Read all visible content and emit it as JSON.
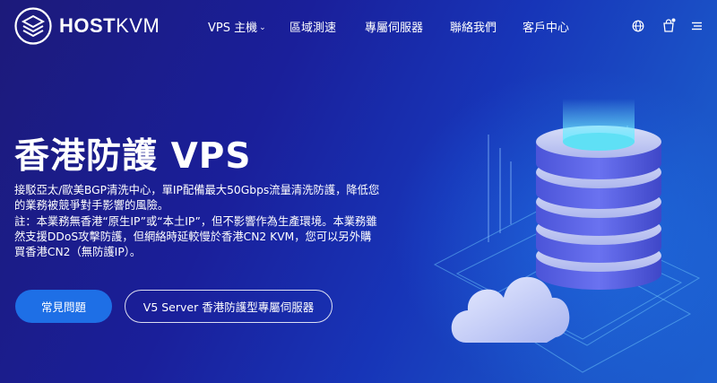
{
  "brand": {
    "name_bold": "HOST",
    "name_light": "KVM"
  },
  "nav": {
    "items": [
      {
        "label": "VPS 主機",
        "has_dropdown": true
      },
      {
        "label": "區域測速"
      },
      {
        "label": "專屬伺服器"
      },
      {
        "label": "聯絡我們"
      },
      {
        "label": "客戶中心"
      }
    ],
    "icons": [
      "globe-icon",
      "cart-icon",
      "menu-icon"
    ]
  },
  "hero": {
    "title": "香港防護 VPS",
    "description_lines": [
      "接駁亞太/歐美BGP清洗中心，單IP配備最大50Gbps流量清洗防護，降低您的業務被競爭對手影響的風險。",
      "註：本業務無香港“原生IP”或“本土IP”，但不影響作為生產環境。本業務雖然支援DDoS攻擊防護，但網絡時延較慢於香港CN2 KVM，您可以另外購買香港CN2（無防護IP）。"
    ],
    "primary_button": "常見問題",
    "secondary_button": "V5 Server 香港防護型專屬伺服器"
  },
  "colors": {
    "background_start": "#1c1a7a",
    "background_end": "#1c5fd0",
    "primary_button": "#1e6fe6",
    "server_disk": "#5a63e6",
    "server_accent": "#4fd6f0"
  }
}
